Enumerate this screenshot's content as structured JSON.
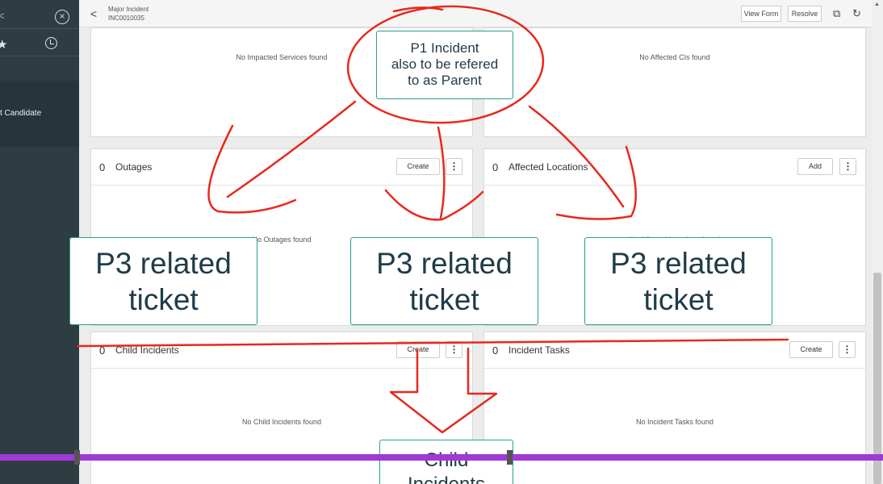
{
  "sidebar": {
    "search_glyph": "<",
    "clear_icon": "×",
    "favorites_glyph": "★",
    "item_label": "t Candidate"
  },
  "header": {
    "back_glyph": "<",
    "title_line1": "Major Incident",
    "title_line2": "INC0010035",
    "view_form_label": "View Form",
    "resolve_label": "Resolve",
    "chat_icon_glyph": "⧉",
    "refresh_icon_glyph": "↻"
  },
  "cards": {
    "impacted_services": {
      "empty_text": "No Impacted Services found"
    },
    "affected_cis": {
      "empty_text": "No Affected CIs found"
    },
    "outages": {
      "count": "0",
      "title": "Outages",
      "button_label": "Create",
      "empty_text": "No Outages found"
    },
    "affected_locations": {
      "count": "0",
      "title": "Affected Locations",
      "button_label": "Add",
      "empty_text": "No Affected Locations found"
    },
    "child_incidents": {
      "count": "0",
      "title": "Child Incidents",
      "button_label": "Create",
      "empty_text": "No Child Incidents found"
    },
    "incident_tasks": {
      "count": "0",
      "title": "Incident Tasks",
      "button_label": "Create",
      "empty_text": "No Incident Tasks found"
    },
    "more_glyph": "⋮"
  },
  "annotations": {
    "p1_line1": "P1 Incident",
    "p1_line2": "also to be refered",
    "p1_line3": "to as Parent",
    "p3_line1": "P3 related",
    "p3_line2": "ticket",
    "child_line1": "Child",
    "child_line2": "Incidents"
  },
  "colors": {
    "annotation_red": "#e8281c",
    "annotation_teal": "#2a9e90",
    "purple_bar": "#a03ad6",
    "sidebar_bg": "#2e3d42"
  }
}
